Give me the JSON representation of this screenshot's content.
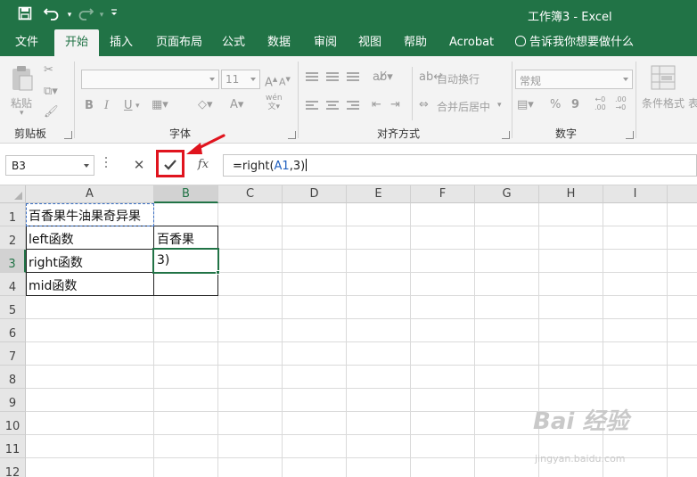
{
  "titlebar": {
    "title": "工作簿3  -  Excel",
    "icons": [
      "save-icon",
      "undo-icon",
      "redo-icon",
      "customize-toolbar-icon"
    ]
  },
  "tabs": [
    {
      "label": "文件"
    },
    {
      "label": "开始",
      "active": true
    },
    {
      "label": "插入"
    },
    {
      "label": "页面布局"
    },
    {
      "label": "公式"
    },
    {
      "label": "数据"
    },
    {
      "label": "审阅"
    },
    {
      "label": "视图"
    },
    {
      "label": "帮助"
    },
    {
      "label": "Acrobat"
    }
  ],
  "tell_me": "告诉我你想要做什么",
  "ribbon": {
    "paste_label": "粘贴",
    "groups": {
      "clipboard": "剪贴板",
      "font": "字体",
      "alignment": "对齐方式",
      "number": "数字"
    },
    "font_size": "11",
    "bold": "B",
    "italic": "I",
    "underline": "U",
    "wrap_text": "自动换行",
    "merge_center": "合并后居中",
    "number_format": "常规",
    "percent": "%",
    "comma": "9",
    "cond_format": "条件格式",
    "table_format": "表"
  },
  "formula_bar": {
    "name_box": "B3",
    "cancel": "✕",
    "confirm": "✓",
    "fx": "fx",
    "formula_prefix": "=right(",
    "formula_ref": "A1",
    "formula_suffix": ",3)"
  },
  "sheet": {
    "columns": [
      "A",
      "B",
      "C",
      "D",
      "E",
      "F",
      "G",
      "H",
      "I"
    ],
    "rows": [
      "1",
      "2",
      "3",
      "4",
      "5",
      "6",
      "7",
      "8",
      "9",
      "10",
      "11",
      "12"
    ],
    "cells": {
      "A1": "百香果牛油果奇异果",
      "A2": "left函数",
      "A3": "right函数",
      "A4": "mid函数",
      "B2": "百香果",
      "B3": "3)"
    },
    "selected_column": "B",
    "selected_row": "3"
  },
  "watermark": {
    "text": "Bai 经验",
    "sub": "jingyan.baidu.com"
  },
  "colors": {
    "excel_green": "#217346",
    "highlight_red": "#e0141e",
    "ref_blue": "#1f5fbf"
  }
}
